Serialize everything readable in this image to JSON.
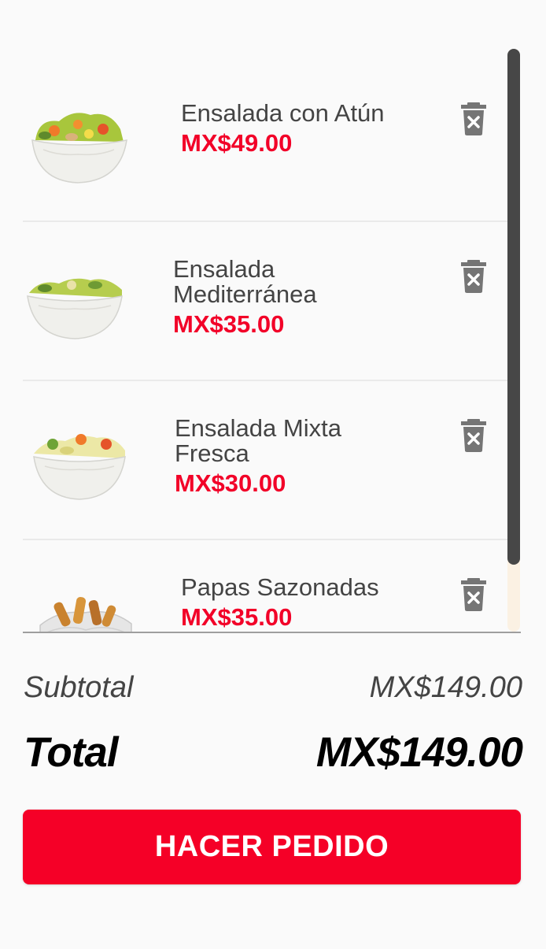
{
  "cart": {
    "items": [
      {
        "name": "Ensalada con Atún",
        "price": "MX$49.00",
        "image": "salad-bowl-tuna"
      },
      {
        "name": "Ensalada Mediterránea",
        "price": "MX$35.00",
        "image": "salad-bowl-mediterranean"
      },
      {
        "name": "Ensalada Mixta Fresca",
        "price": "MX$30.00",
        "image": "salad-bowl-mixed"
      },
      {
        "name": "Papas Sazonadas",
        "price": "MX$35.00",
        "image": "seasoned-fries"
      }
    ],
    "delete_icon": "trash-delete-icon"
  },
  "summary": {
    "subtotal_label": "Subtotal",
    "subtotal_value": "MX$149.00",
    "total_label": "Total",
    "total_value": "MX$149.00"
  },
  "actions": {
    "order_label": "HACER PEDIDO"
  },
  "colors": {
    "accent": "#f50027",
    "price": "#f20028",
    "scrollbar_thumb": "#474747",
    "scrollbar_track": "#fbf1e3"
  }
}
